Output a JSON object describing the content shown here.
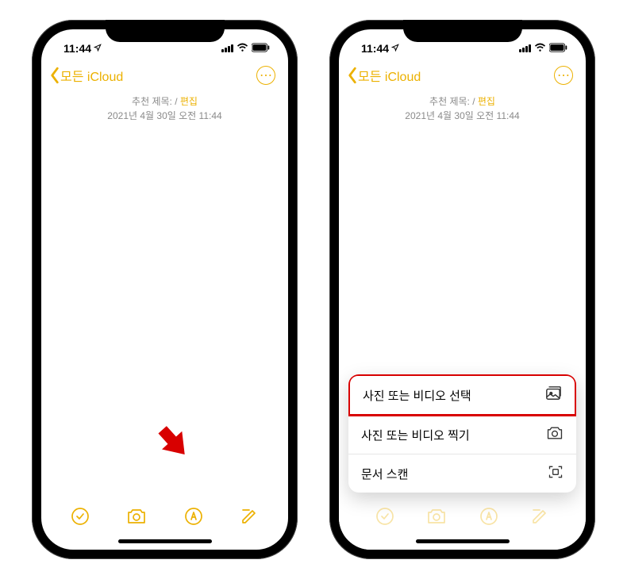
{
  "status": {
    "time": "11:44",
    "wifi_label": "wifi",
    "battery_label": "battery"
  },
  "nav": {
    "back_label": "모든 iCloud",
    "more_label": "⋯"
  },
  "header": {
    "suggested_title_prefix": "추천 제목: /",
    "edit_label": "편집",
    "date": "2021년 4월 30일 오전 11:44"
  },
  "menu": {
    "choose": "사진 또는 비디오 선택",
    "take": "사진 또는 비디오 찍기",
    "scan": "문서 스캔"
  },
  "toolbar": {
    "checklist": "checklist",
    "camera": "camera",
    "markup": "markup",
    "compose": "compose"
  }
}
